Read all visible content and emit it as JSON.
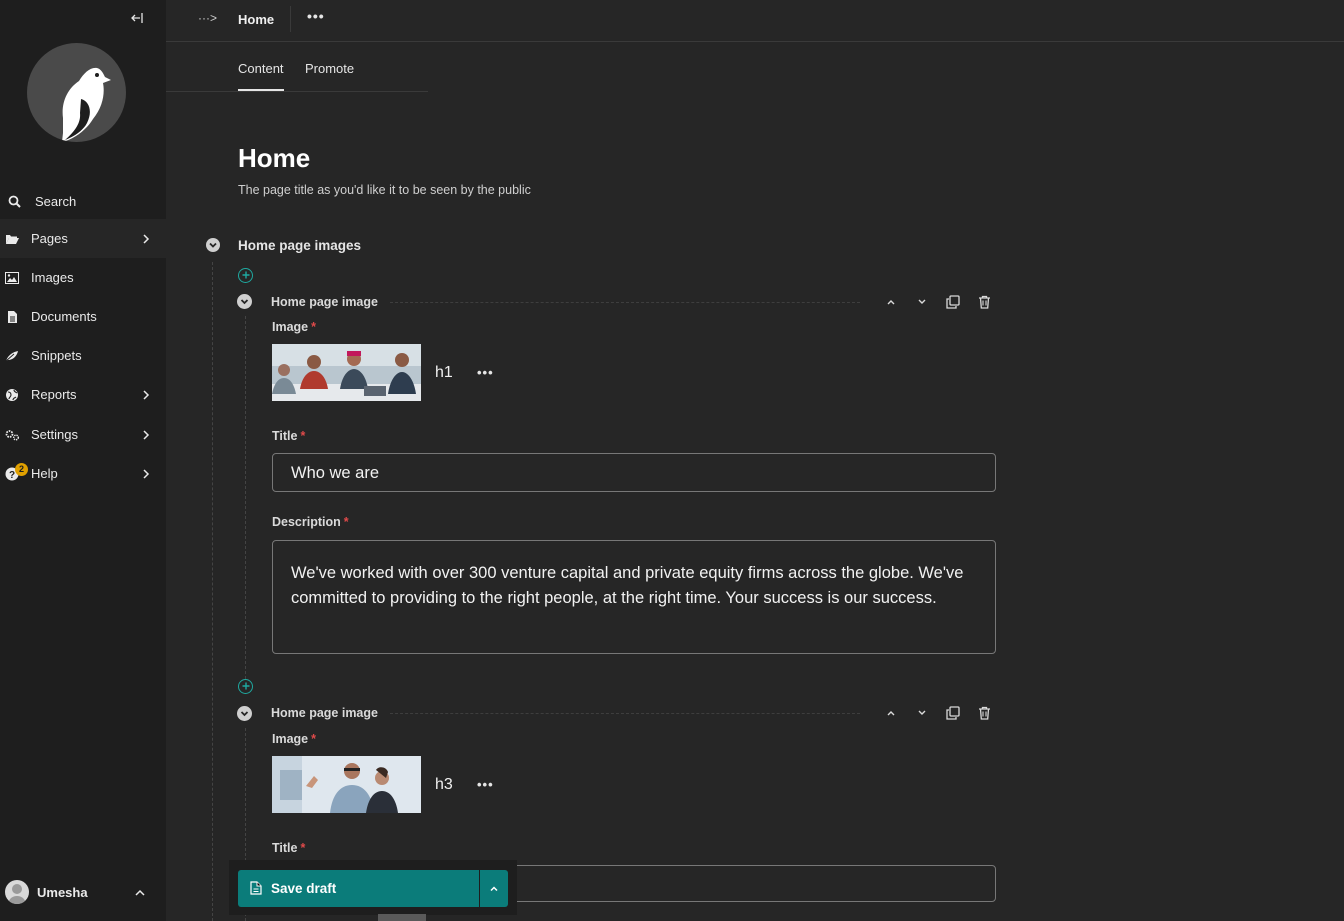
{
  "sidebar": {
    "collapse_label": "←|",
    "menu": [
      {
        "label": "Search",
        "icon": "search-icon"
      },
      {
        "label": "Pages",
        "icon": "folder-open-icon",
        "submenu": true
      },
      {
        "label": "Images",
        "icon": "image-icon"
      },
      {
        "label": "Documents",
        "icon": "document-icon"
      },
      {
        "label": "Snippets",
        "icon": "snippet-icon"
      },
      {
        "label": "Reports",
        "icon": "globe-icon",
        "submenu": true
      },
      {
        "label": "Settings",
        "icon": "cogs-icon",
        "submenu": true
      },
      {
        "label": "Help",
        "icon": "help-icon",
        "submenu": true,
        "badge": "2"
      }
    ],
    "user": {
      "name": "Umesha"
    }
  },
  "header": {
    "breadcrumb_toggle": "···>",
    "page": "Home",
    "more": "•••"
  },
  "tabs": [
    {
      "label": "Content",
      "active": true
    },
    {
      "label": "Promote",
      "active": false
    }
  ],
  "page_title": {
    "value": "Home",
    "help": "The page title as you'd like it to be seen by the public"
  },
  "section": {
    "title": "Home page images",
    "blocks": [
      {
        "title": "Home page image",
        "image_label": "Image",
        "image_name": "h1",
        "title_label": "Title",
        "title_value": "Who we are",
        "description_label": "Description",
        "description_value": "We've worked with over 300 venture capital and private equity firms across the globe. We've committed to providing to the right people, at the right time. Your success is our success."
      },
      {
        "title": "Home page image",
        "image_label": "Image",
        "image_name": "h3",
        "title_label": "Title",
        "title_value": ""
      }
    ]
  },
  "footer": {
    "save_label": "Save draft"
  },
  "colors": {
    "accent": "#0b7c7a",
    "add_button": "#1fa9a0",
    "required": "#e04a4a",
    "badge": "#e0a000"
  }
}
